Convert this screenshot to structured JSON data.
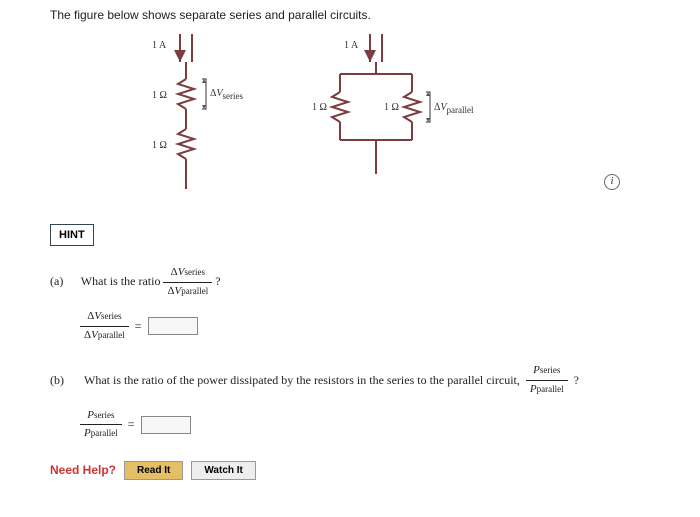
{
  "intro": "The figure below shows separate series and parallel circuits.",
  "circuit": {
    "current": "1 A",
    "res": "1 Ω",
    "dv_series": "ΔVseries",
    "dv_parallel": "ΔVparallel"
  },
  "info_icon": "i",
  "hint": "HINT",
  "part_a": {
    "label": "(a)",
    "q1": "What is the ratio",
    "qmark": "?",
    "frac_num": "ΔVseries",
    "frac_den": "ΔVparallel",
    "eq": "="
  },
  "part_b": {
    "label": "(b)",
    "q": "What is the ratio of the power dissipated by the resistors in the series to the parallel circuit,",
    "frac_num": "Pseries",
    "frac_den": "Pparallel",
    "qmark": "?",
    "eq": "="
  },
  "need_help": "Need Help?",
  "read_it": "Read It",
  "watch_it": "Watch It"
}
